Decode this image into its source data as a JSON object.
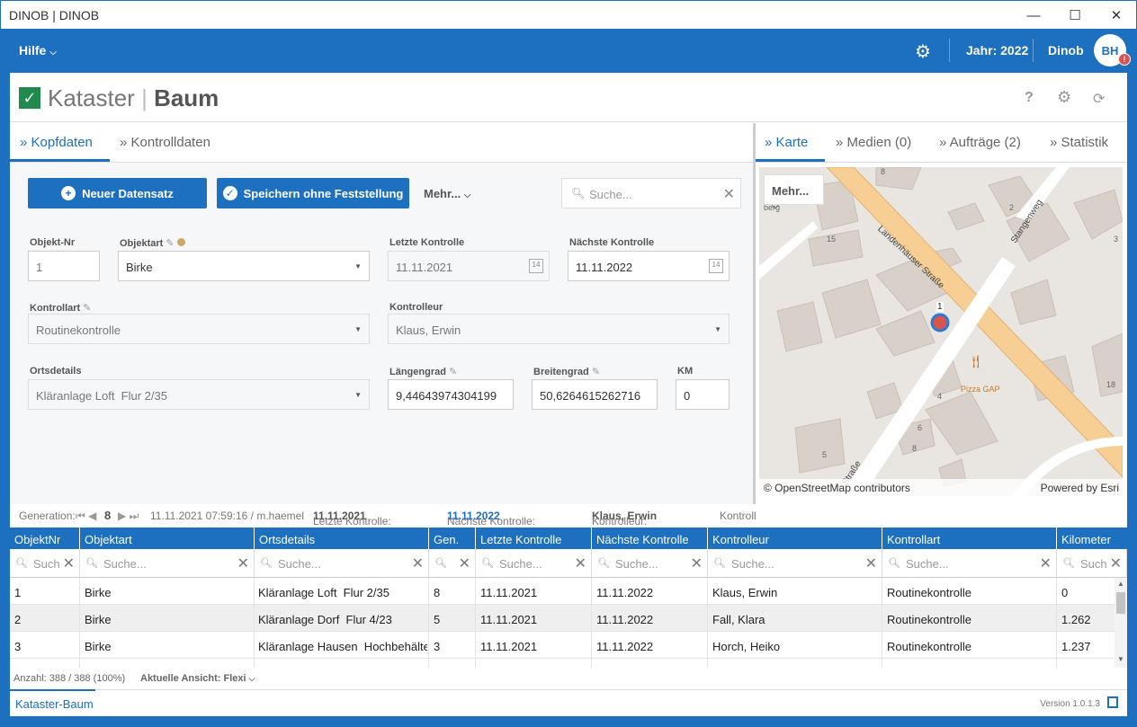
{
  "window": {
    "title": "DINOB | DINOB",
    "min": "—",
    "max": "☐",
    "close": "✕"
  },
  "topbar": {
    "help": "Hilfe",
    "year": "Jahr: 2022",
    "user": "Dinob",
    "initials": "BH",
    "badge": "!"
  },
  "header": {
    "title_left": "Kataster",
    "title_sep": "|",
    "title_right": "Baum",
    "help": "?"
  },
  "left_tabs": [
    {
      "label": "» Kopfdaten"
    },
    {
      "label": "» Kontrolldaten"
    }
  ],
  "right_tabs": [
    {
      "label": "» Karte"
    },
    {
      "label": "» Medien (0)"
    },
    {
      "label": "» Aufträge (2)"
    },
    {
      "label": "» Statistik"
    }
  ],
  "toolbar": {
    "new_label": "Neuer Datensatz",
    "save_label": "Speichern ohne Feststellung",
    "more_label": "Mehr...",
    "search_placeholder": "Suche..."
  },
  "form": {
    "objekt_nr_label": "Objekt-Nr",
    "objekt_nr": "1",
    "objektart_label": "Objektart",
    "objektart": "Birke",
    "letzte_label": "Letzte Kontrolle",
    "letzte": "11.11.2021",
    "naechste_label": "Nächste Kontrolle",
    "naechste": "11.11.2022",
    "kontrollart_label": "Kontrollart",
    "kontrollart": "Routinekontrolle",
    "kontrolleur_label": "Kontrolleur",
    "kontrolleur": "Klaus, Erwin",
    "ortsdetails_label": "Ortsdetails",
    "ortsdetails": "Kläranlage Loft  Flur 2/35",
    "laengengrad_label": "Längengrad",
    "laengengrad": "9,44643974304199",
    "breitengrad_label": "Breitengrad",
    "breitengrad": "50,6264615262716",
    "km_label": "KM",
    "km": "0"
  },
  "map": {
    "more_label": "Mehr...",
    "street1": "Landenhäuser Straße",
    "street2": "Stangenweg",
    "street3": "Straße",
    "poi": "Pizza GAP",
    "attribution_left": "© OpenStreetMap contributors",
    "attribution_right": "Powered by Esri",
    "marker_label": "1",
    "numbers": [
      "8",
      "15",
      "2",
      "3",
      "4",
      "6",
      "8",
      "5",
      "18",
      "berg"
    ]
  },
  "genbar": {
    "gen_label": "Generation:",
    "gen_value": "8",
    "timestamp": "11.11.2021 07:59:16 / m.haemel",
    "letzte_label": "Letzte Kontrolle:",
    "letzte": "11.11.2021",
    "naechste_label": "Nächste Kontrolle:",
    "naechste": "11.11.2022",
    "kontrolleur_label": "Kontrolleur:",
    "kontrolleur": "Klaus, Erwin",
    "kontroll_more": "Kontroll"
  },
  "grid": {
    "headers": [
      "ObjektNr",
      "Objektart",
      "Ortsdetails",
      "Gen.",
      "Letzte Kontrolle",
      "Nächste Kontrolle",
      "Kontrolleur",
      "Kontrollart",
      "Kilometer"
    ],
    "search_placeholders": [
      "Such",
      "Suche...",
      "Suche...",
      "",
      "Suche...",
      "Suche...",
      "Suche...",
      "Suche...",
      "Such"
    ],
    "rows": [
      [
        "1",
        "Birke",
        "Kläranlage Loft  Flur 2/35",
        "8",
        "11.11.2021",
        "11.11.2022",
        "Klaus, Erwin",
        "Routinekontrolle",
        "0"
      ],
      [
        "2",
        "Birke",
        "Kläranlage Dorf  Flur 4/23",
        "5",
        "11.11.2021",
        "11.11.2022",
        "Fall, Klara",
        "Routinekontrolle",
        "1.262"
      ],
      [
        "3",
        "Birke",
        "Kläranlage Hausen  Hochbehälter",
        "3",
        "11.11.2021",
        "11.11.2022",
        "Horch, Heiko",
        "Routinekontrolle",
        "1.237"
      ]
    ]
  },
  "footer": {
    "count": "Anzahl: 388 / 388 (100%)",
    "view": "Aktuelle Ansicht: Flexi",
    "module": "Kataster-Baum",
    "version": "Version 1.0.1.3"
  }
}
